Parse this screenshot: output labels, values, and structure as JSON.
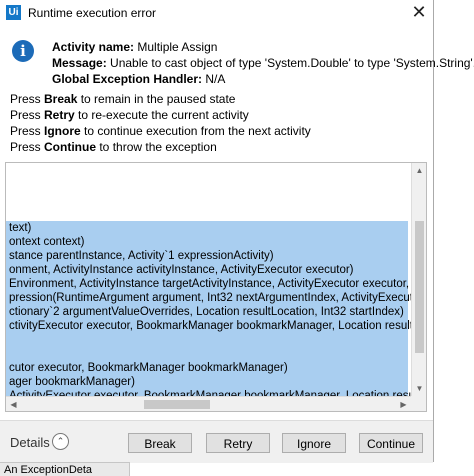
{
  "window": {
    "app_icon_text": "Ui",
    "title": "Runtime execution error",
    "close_glyph": "✕"
  },
  "info": {
    "icon": "info-icon",
    "activity_label": "Activity name:",
    "activity_value": "Multiple Assign",
    "message_label": "Message:",
    "message_value": "Unable to cast object of type 'System.Double' to type 'System.String'.",
    "handler_label": "Global Exception Handler:",
    "handler_value": "N/A"
  },
  "instructions": [
    {
      "prefix": "Press ",
      "key": "Break",
      "suffix": " to remain in the paused state"
    },
    {
      "prefix": "Press ",
      "key": "Retry",
      "suffix": " to re-execute the current activity"
    },
    {
      "prefix": "Press ",
      "key": "Ignore",
      "suffix": " to continue execution from the next activity"
    },
    {
      "prefix": "Press ",
      "key": "Continue",
      "suffix": " to throw the exception"
    }
  ],
  "trace": {
    "lines": [
      {
        "text": "",
        "selected": false
      },
      {
        "text": "",
        "selected": false
      },
      {
        "text": "",
        "selected": false
      },
      {
        "text": "",
        "selected": false
      },
      {
        "text": "text)",
        "selected": true
      },
      {
        "text": "ontext context)",
        "selected": true
      },
      {
        "text": "stance parentInstance, Activity`1 expressionActivity)",
        "selected": true
      },
      {
        "text": "onment, ActivityInstance activityInstance, ActivityExecutor executor)",
        "selected": true
      },
      {
        "text": "Environment, ActivityInstance targetActivityInstance, ActivityExecutor executor, Object argu",
        "selected": true
      },
      {
        "text": "pression(RuntimeArgument argument, Int32 nextArgumentIndex, ActivityExecutor executor",
        "selected": true
      },
      {
        "text": "ctionary`2 argumentValueOverrides, Location resultLocation, Int32 startIndex)",
        "selected": true
      },
      {
        "text": "ctivityExecutor executor, BookmarkManager bookmarkManager, Location resultLocation)",
        "selected": true
      },
      {
        "text": "",
        "selected": true
      },
      {
        "text": "",
        "selected": true
      },
      {
        "text": "cutor executor, BookmarkManager bookmarkManager)",
        "selected": true
      },
      {
        "text": "ager bookmarkManager)",
        "selected": true
      },
      {
        "text": "ActivityExecutor executor, BookmarkManager bookmarkManager, Location resultLocation)",
        "selected": true
      }
    ]
  },
  "footer": {
    "details_label": "Details",
    "details_toggle_glyph": "⌃",
    "buttons": {
      "break": "Break",
      "retry": "Retry",
      "ignore": "Ignore",
      "continue": "Continue"
    }
  },
  "background_tab": {
    "label": "An ExceptionDeta"
  }
}
